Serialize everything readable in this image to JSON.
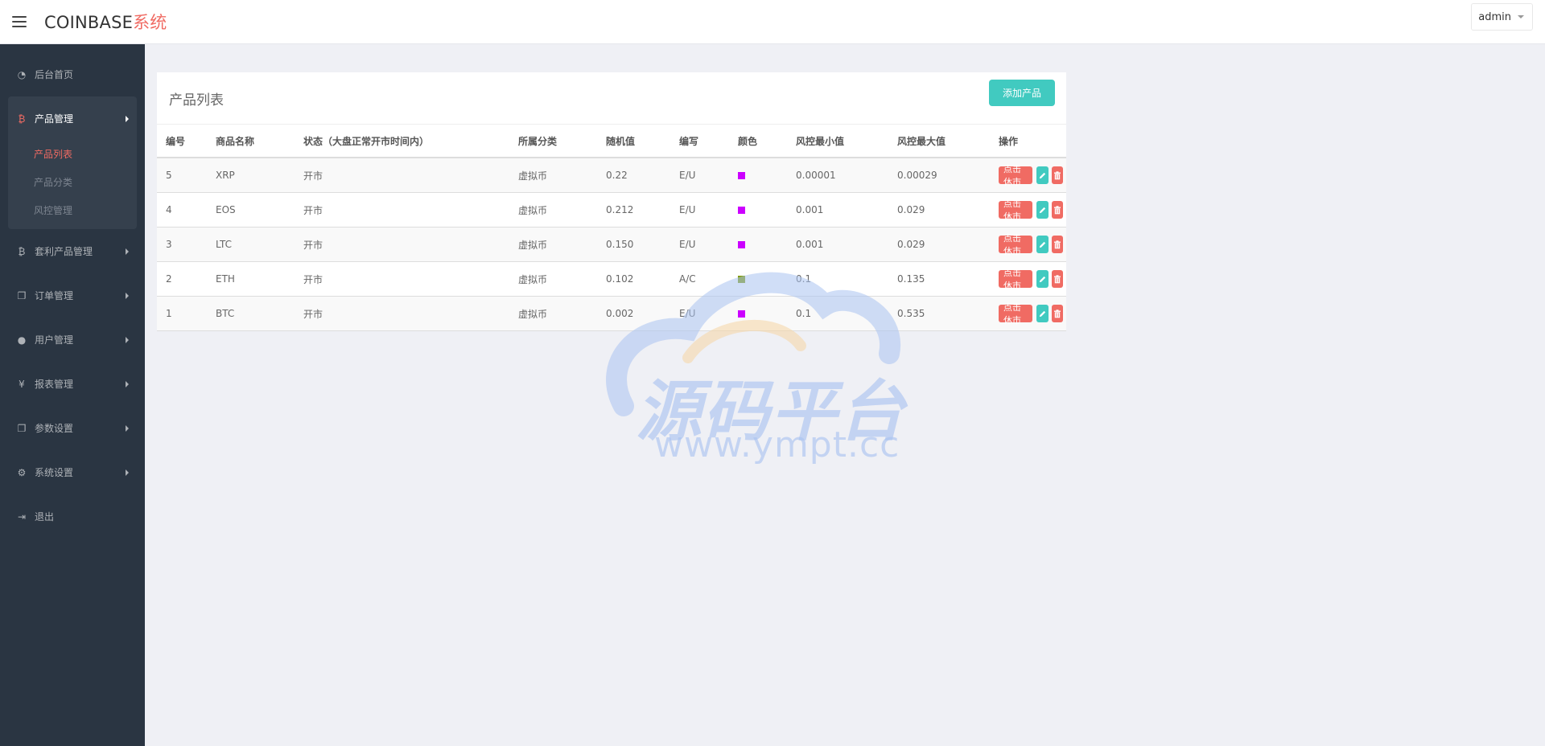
{
  "header": {
    "brand_main": "COINBASE",
    "brand_accent": "系统",
    "user": "admin"
  },
  "sidebar": {
    "items": [
      {
        "label": "后台首页",
        "icon": "dashboard-icon"
      },
      {
        "label": "产品管理",
        "icon": "bitcoin-icon",
        "expanded": true,
        "children": [
          {
            "label": "产品列表",
            "active": true
          },
          {
            "label": "产品分类"
          },
          {
            "label": "风控管理"
          }
        ]
      },
      {
        "label": "套利产品管理",
        "icon": "bitcoin-icon"
      },
      {
        "label": "订单管理",
        "icon": "copy-icon"
      },
      {
        "label": "用户管理",
        "icon": "user-icon"
      },
      {
        "label": "报表管理",
        "icon": "yen-icon"
      },
      {
        "label": "参数设置",
        "icon": "copy-icon"
      },
      {
        "label": "系统设置",
        "icon": "gears-icon"
      },
      {
        "label": "退出",
        "icon": "sign-out-icon"
      }
    ]
  },
  "panel": {
    "title": "产品列表",
    "add_button": "添加产品",
    "columns": [
      "编号",
      "商品名称",
      "状态（大盘正常开市时间内）",
      "所属分类",
      "随机值",
      "编写",
      "颜色",
      "风控最小值",
      "风控最大值",
      "操作"
    ],
    "rows": [
      {
        "id": "5",
        "name": "XRP",
        "status": "开市",
        "category": "虚拟币",
        "random": "0.22",
        "code": "E/U",
        "color": "#cc00ff",
        "min": "0.00001",
        "max": "0.00029"
      },
      {
        "id": "4",
        "name": "EOS",
        "status": "开市",
        "category": "虚拟币",
        "random": "0.212",
        "code": "E/U",
        "color": "#cc00ff",
        "min": "0.001",
        "max": "0.029"
      },
      {
        "id": "3",
        "name": "LTC",
        "status": "开市",
        "category": "虚拟币",
        "random": "0.150",
        "code": "E/U",
        "color": "#cc00ff",
        "min": "0.001",
        "max": "0.029"
      },
      {
        "id": "2",
        "name": "ETH",
        "status": "开市",
        "category": "虚拟币",
        "random": "0.102",
        "code": "A/C",
        "color": "#7f9900",
        "min": "0.1",
        "max": "0.135"
      },
      {
        "id": "1",
        "name": "BTC",
        "status": "开市",
        "category": "虚拟币",
        "random": "0.002",
        "code": "E/U",
        "color": "#cc00ff",
        "min": "0.1",
        "max": "0.535"
      }
    ],
    "row_action_label": "点击休市"
  },
  "watermark": {
    "text": "源码平台",
    "url": "www.ympt.cc"
  }
}
